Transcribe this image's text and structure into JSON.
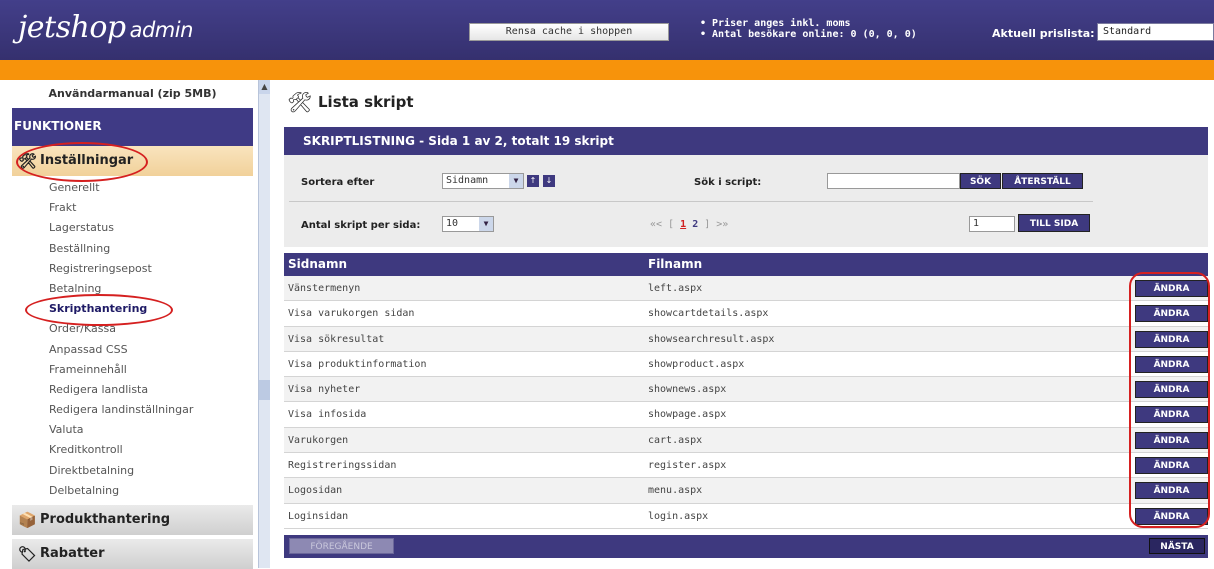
{
  "header": {
    "logo_text": "jetshop",
    "logo_sub": "admin",
    "cache_button": "Rensa cache i shoppen",
    "info": [
      "Priser anges inkl. moms",
      "Antal besökare online: 0 (0, 0, 0)"
    ],
    "pricelist_label": "Aktuell prislista:",
    "pricelist_value": "Standard"
  },
  "sidebar": {
    "manual_link": "Användarmanual (zip 5MB)",
    "functions_title": "FUNKTIONER",
    "sections": {
      "settings": "Inställningar",
      "products": "Produkthantering",
      "discounts": "Rabatter"
    },
    "items": [
      {
        "label": "Generellt"
      },
      {
        "label": "Frakt"
      },
      {
        "label": "Lagerstatus"
      },
      {
        "label": "Beställning"
      },
      {
        "label": "Registreringsepost"
      },
      {
        "label": "Betalning"
      },
      {
        "label": "Skripthantering"
      },
      {
        "label": "Order/Kassa"
      },
      {
        "label": "Anpassad CSS"
      },
      {
        "label": "Frameinnehåll"
      },
      {
        "label": "Redigera landlista"
      },
      {
        "label": "Redigera landinställningar"
      },
      {
        "label": "Valuta"
      },
      {
        "label": "Kreditkontroll"
      },
      {
        "label": "Direktbetalning"
      },
      {
        "label": "Delbetalning"
      }
    ],
    "active_item": "Skripthantering"
  },
  "main": {
    "title": "Lista skript",
    "panel_title": "SKRIPTLISTNING - Sida 1 av 2, totalt 19 skript",
    "sort_label": "Sortera efter",
    "sort_value": "Sidnamn",
    "search_label": "Sök i script:",
    "search_value": "",
    "search_button": "SÖK",
    "reset_button": "ÅTERSTÄLL",
    "per_page_label": "Antal skript per sida:",
    "per_page_value": "10",
    "pager": {
      "prev": "«< [",
      "current": "1",
      "other": "2",
      "next": "] >»"
    },
    "goto_value": "1",
    "goto_button": "TILL SIDA",
    "col_page": "Sidnamn",
    "col_file": "Filnamn",
    "edit_label": "ÄNDRA",
    "rows": [
      {
        "page": "Vänstermenyn",
        "file": "left.aspx"
      },
      {
        "page": "Visa varukorgen sidan",
        "file": "showcartdetails.aspx"
      },
      {
        "page": "Visa sökresultat",
        "file": "showsearchresult.aspx"
      },
      {
        "page": "Visa produktinformation",
        "file": "showproduct.aspx"
      },
      {
        "page": "Visa nyheter",
        "file": "shownews.aspx"
      },
      {
        "page": "Visa infosida",
        "file": "showpage.aspx"
      },
      {
        "page": "Varukorgen",
        "file": "cart.aspx"
      },
      {
        "page": "Registreringssidan",
        "file": "register.aspx"
      },
      {
        "page": "Logosidan",
        "file": "menu.aspx"
      },
      {
        "page": "Loginsidan",
        "file": "login.aspx"
      }
    ],
    "prev_button": "FÖREGÅENDE",
    "next_button": "NÄSTA"
  },
  "colors": {
    "primary": "#3e397f",
    "accent": "#f7930b",
    "highlight": "#d52020"
  }
}
